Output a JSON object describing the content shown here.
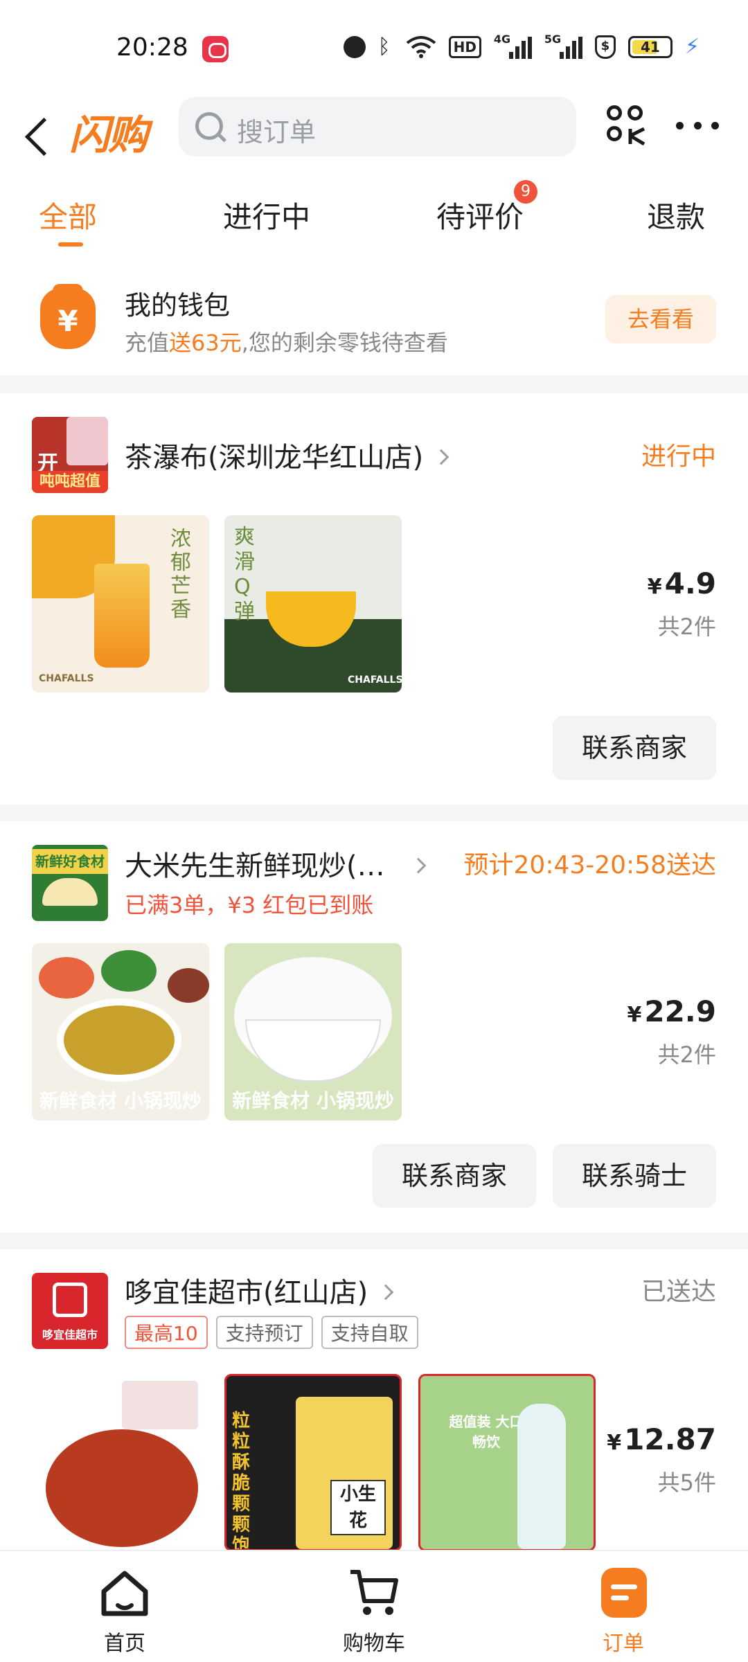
{
  "status_bar": {
    "time": "20:28",
    "battery": "41",
    "network_1": "4G",
    "network_2": "5G",
    "hd": "HD"
  },
  "header": {
    "logo": "闪购",
    "search_placeholder": "搜订单"
  },
  "tabs": [
    {
      "label": "全部",
      "active": true
    },
    {
      "label": "进行中"
    },
    {
      "label": "待评价",
      "badge": "9"
    },
    {
      "label": "退款"
    }
  ],
  "wallet": {
    "title": "我的钱包",
    "sub_prefix": "充值",
    "sub_highlight": "送63元",
    "sub_suffix": ",您的剩余零钱待查看",
    "button": "去看看",
    "icon_glyph": "¥"
  },
  "orders": [
    {
      "store": "茶瀑布(深圳龙华红山店)",
      "logo_text_1": "开",
      "logo_text_2": "吨吨超值",
      "status": "进行中",
      "thumb_1_text": "浓郁芒香",
      "thumb_1_brand": "CHAFALLS",
      "thumb_2_text": "爽滑Q弹",
      "thumb_2_brand": "CHAFALLS",
      "currency": "¥",
      "price": "4.9",
      "count": "共2件",
      "buttons": [
        "联系商家"
      ]
    },
    {
      "store": "大米先生新鲜现炒(…",
      "logo_text": "新鲜好食材",
      "status": "预计20:43-20:58送达",
      "promo": "已满3单，¥3 红包已到账",
      "thumb_1_text": "新鲜食材 小锅现炒",
      "thumb_2_text": "新鲜食材 小锅现炒",
      "currency": "¥",
      "price": "22.9",
      "count": "共2件",
      "buttons": [
        "联系商家",
        "联系骑士"
      ]
    },
    {
      "store": "哆宜佳超市(红山店)",
      "logo_text": "哆宜佳超市",
      "status": "已送达",
      "tags": [
        "最高10",
        "支持预订",
        "支持自取"
      ],
      "thumb_2_text": "粒粒酥脆 颗颗饱满",
      "thumb_2_label": "小生花",
      "thumb_3_text": "超值装 大口畅饮",
      "currency": "¥",
      "price": "12.87",
      "count": "共5件"
    }
  ],
  "bottom_nav": [
    {
      "label": "首页"
    },
    {
      "label": "购物车"
    },
    {
      "label": "订单",
      "active": true
    }
  ],
  "colors": {
    "accent": "#f57c1f",
    "red": "#f0523a",
    "muted": "#888888"
  }
}
